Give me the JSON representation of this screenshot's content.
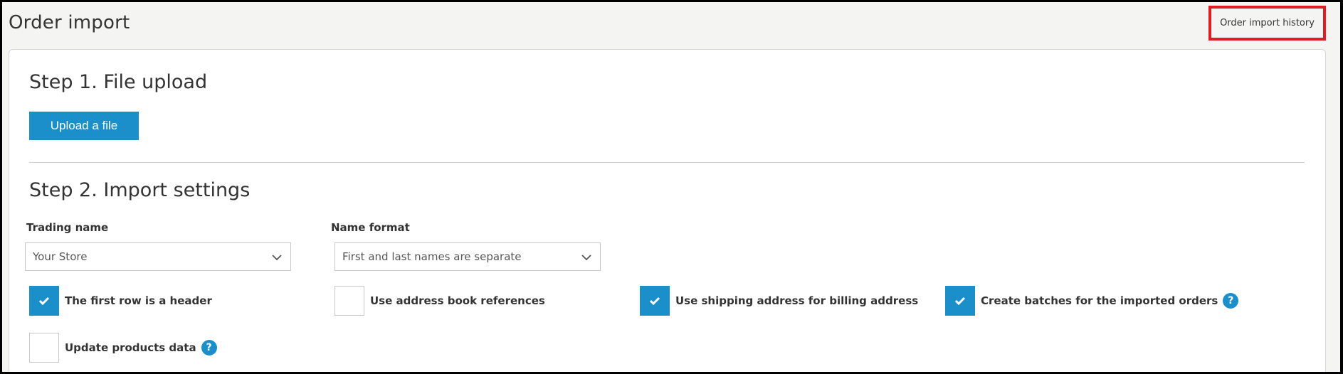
{
  "page": {
    "title": "Order import",
    "history_link": "Order import history"
  },
  "step1": {
    "title": "Step 1. File upload",
    "upload_label": "Upload a file"
  },
  "step2": {
    "title": "Step 2. Import settings",
    "trading_name": {
      "label": "Trading name",
      "value": "Your Store"
    },
    "name_format": {
      "label": "Name format",
      "value": "First and last names are separate"
    },
    "options": [
      {
        "label": "The first row is a header",
        "checked": true,
        "help": false
      },
      {
        "label": "Use address book references",
        "checked": false,
        "help": false
      },
      {
        "label": "Use shipping address for billing address",
        "checked": true,
        "help": false
      },
      {
        "label": "Create batches for the imported orders",
        "checked": true,
        "help": true
      },
      {
        "label": "Update products data",
        "checked": false,
        "help": true
      }
    ],
    "help_glyph": "?"
  },
  "colors": {
    "accent": "#1a8fc9",
    "highlight_border": "#e01b24",
    "background": "#f4f4f2"
  },
  "icons": {
    "chevron": "chevron-down-icon",
    "check": "checkmark-icon",
    "help": "help-icon"
  }
}
